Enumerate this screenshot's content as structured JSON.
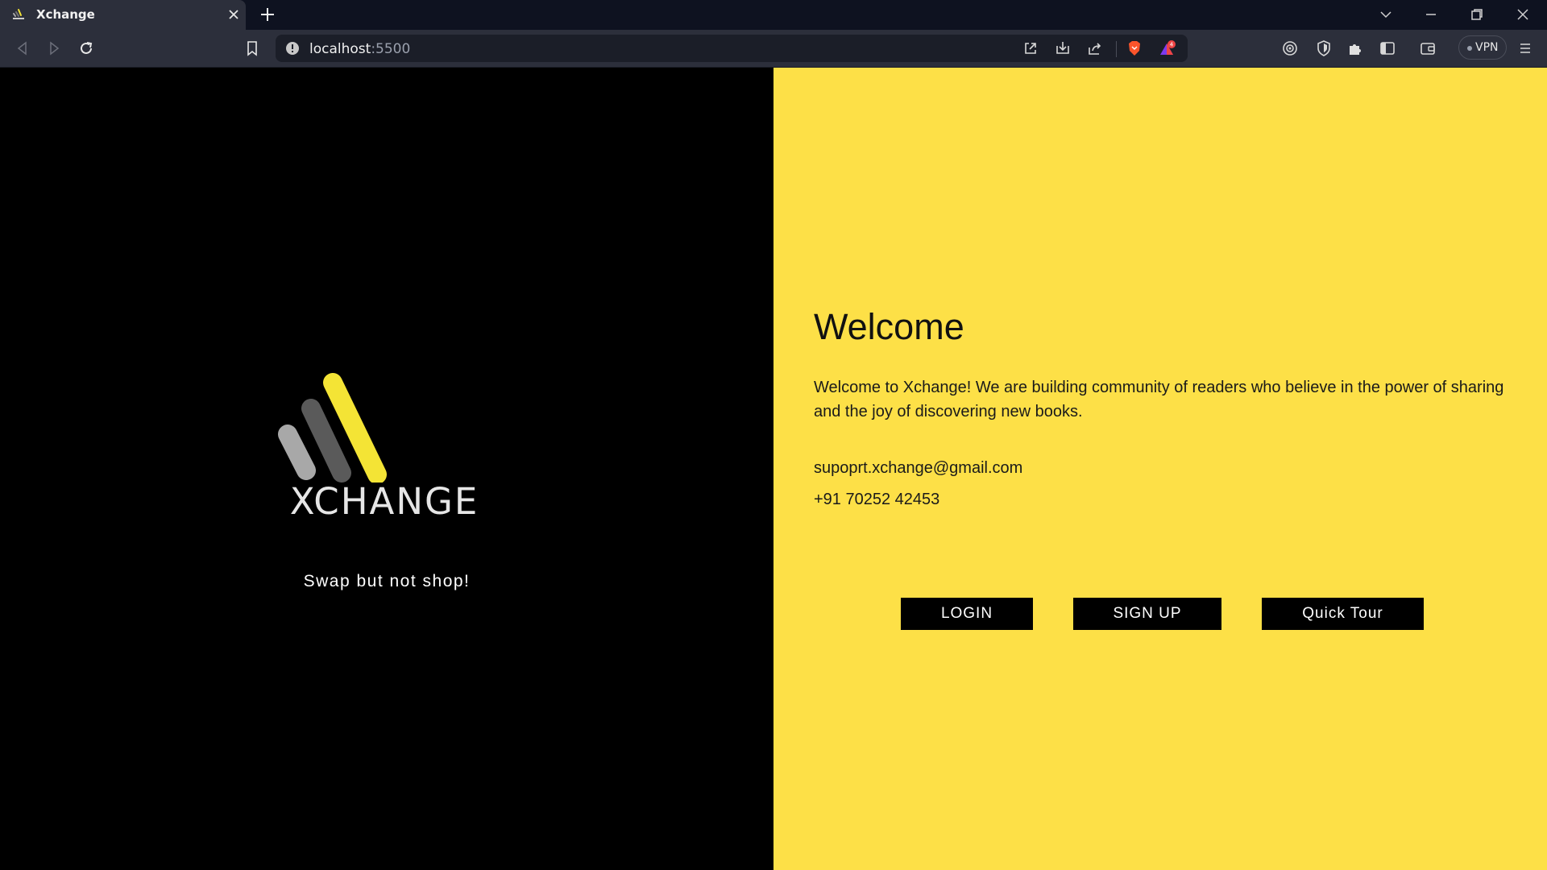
{
  "browser": {
    "tab": {
      "title": "Xchange"
    },
    "url": {
      "host": "localhost",
      "port": ":5500"
    },
    "vpn_label": "VPN",
    "rewards_badge_count": "4",
    "colors": {
      "tab_bar": "#0e1220",
      "toolbar": "#2c2f3b",
      "brave_orange": "#fb542b"
    },
    "icons": {
      "tab_favicon": "xchange-logo-icon",
      "tab_close": "close-icon",
      "new_tab": "plus-icon",
      "tab_search": "chevron-down-icon",
      "minimize": "minimize-icon",
      "restore": "restore-icon",
      "close_window": "close-icon",
      "back": "back-icon",
      "forward": "forward-icon",
      "reload": "reload-icon",
      "bookmark": "bookmark-icon",
      "site_info": "info-icon",
      "open_external": "open-external-icon",
      "install": "install-icon",
      "share": "share-icon",
      "brave_shields": "brave-lion-icon",
      "brave_rewards": "rewards-triangle-icon",
      "leo": "leo-icon",
      "extension_shield": "shield-icon",
      "extensions": "puzzle-icon",
      "sidebar": "sidebar-icon",
      "wallet": "wallet-icon",
      "menu": "menu-icon"
    }
  },
  "left": {
    "logo_text": "XCHANGE",
    "tagline": "Swap but not shop!",
    "colors": {
      "background": "#000000",
      "logo_yellow": "#f4e435",
      "logo_dark_gray": "#5a5a5a",
      "logo_light_gray": "#a8a8a8"
    }
  },
  "right": {
    "title": "Welcome",
    "description": "Welcome to Xchange! We are building community of readers who believe in the power of sharing and the joy of discovering new books.",
    "email": "supoprt.xchange@gmail.com",
    "phone": "+91 70252 42453",
    "buttons": {
      "login": "LOGIN",
      "signup": "SIGN UP",
      "tour": "Quick Tour"
    },
    "colors": {
      "background": "#fde047",
      "button_bg": "#000000",
      "button_text": "#ffffff"
    }
  }
}
